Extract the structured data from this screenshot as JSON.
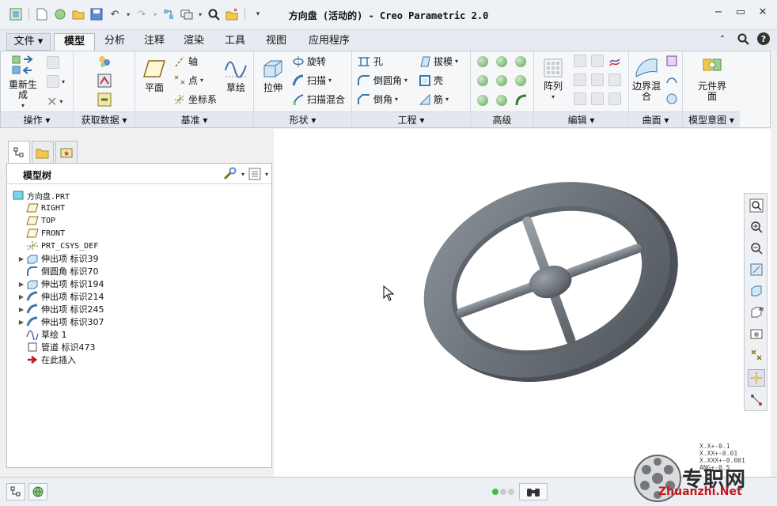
{
  "window": {
    "title": "方向盘 (活动的) - Creo Parametric 2.0",
    "quick_access_icons": [
      "regenerate-small-icon",
      "new-icon",
      "rebuild-icon",
      "open-icon",
      "save-icon",
      "undo-icon",
      "redo-icon",
      "regen-manager-icon",
      "windows-icon",
      "search-icon",
      "close-window-icon",
      "customize-icon"
    ]
  },
  "tabs": [
    {
      "label": "文件 ▾",
      "active": false
    },
    {
      "label": "模型",
      "active": true
    },
    {
      "label": "分析",
      "active": false
    },
    {
      "label": "注释",
      "active": false
    },
    {
      "label": "渲染",
      "active": false
    },
    {
      "label": "工具",
      "active": false
    },
    {
      "label": "视图",
      "active": false
    },
    {
      "label": "应用程序",
      "active": false
    }
  ],
  "ribbon": {
    "groups": {
      "operations": "操作 ▾",
      "get_data": "获取数据 ▾",
      "datum": "基准 ▾",
      "shapes": "形状 ▾",
      "engineering": "工程 ▾",
      "advanced": "高级",
      "editing": "编辑 ▾",
      "surfaces": "曲面 ▾",
      "model_intent": "模型意图 ▾"
    },
    "buttons": {
      "regenerate": "重新生成",
      "plane": "平面",
      "axis": "轴",
      "point": "点",
      "csys": "坐标系",
      "sketch": "草绘",
      "extrude": "拉伸",
      "revolve": "旋转",
      "sweep": "扫描",
      "swept_blend": "扫描混合",
      "hole": "孔",
      "round": "倒圆角",
      "chamfer": "倒角",
      "draft": "拔模",
      "shell": "壳",
      "rib": "筋",
      "pattern": "阵列",
      "boundary_blend": "边界混合",
      "component_interface": "元件界面"
    }
  },
  "model_tree": {
    "title": "模型树",
    "items": [
      {
        "label": "方向盘.PRT",
        "icon": "part-icon",
        "expandable": false,
        "level": 0
      },
      {
        "label": "RIGHT",
        "icon": "datum-plane-icon",
        "expandable": false,
        "level": 1
      },
      {
        "label": "TOP",
        "icon": "datum-plane-icon",
        "expandable": false,
        "level": 1
      },
      {
        "label": "FRONT",
        "icon": "datum-plane-icon",
        "expandable": false,
        "level": 1
      },
      {
        "label": "PRT_CSYS_DEF",
        "icon": "csys-icon",
        "expandable": false,
        "level": 1
      },
      {
        "label": "伸出项 标识39",
        "icon": "protrusion-icon",
        "expandable": true,
        "level": 1
      },
      {
        "label": "倒圆角 标识70",
        "icon": "round-icon",
        "expandable": false,
        "level": 1
      },
      {
        "label": "伸出项 标识194",
        "icon": "protrusion-icon",
        "expandable": true,
        "level": 1
      },
      {
        "label": "伸出项 标识214",
        "icon": "sweep-protrusion-icon",
        "expandable": true,
        "level": 1
      },
      {
        "label": "伸出项 标识245",
        "icon": "sweep-protrusion-icon",
        "expandable": true,
        "level": 1
      },
      {
        "label": "伸出项 标识307",
        "icon": "sweep-protrusion-icon",
        "expandable": true,
        "level": 1
      },
      {
        "label": "草绘 1",
        "icon": "sketch-icon",
        "expandable": false,
        "level": 1
      },
      {
        "label": "管道 标识473",
        "icon": "pipe-icon",
        "expandable": false,
        "level": 1
      },
      {
        "label": "在此插入",
        "icon": "insert-here-arrow-icon",
        "expandable": false,
        "level": 1
      }
    ]
  },
  "right_toolbar_icons": [
    "refit-icon",
    "zoom-in-icon",
    "zoom-out-icon",
    "repaint-icon",
    "display-style-icon",
    "saved-views-icon",
    "view-manager-icon",
    "datum-display-icon",
    "spin-center-icon",
    "annotation-display-icon"
  ],
  "tolerance_readout": [
    "X.X+-0.1",
    "X.XX+-0.01",
    "X.XXX+-0.001",
    "ANG+-0.5"
  ],
  "watermark": {
    "text": "专职网",
    "url": "Zhuanzhi.Net"
  },
  "colors": {
    "accent_green": "#5ea65a",
    "model_gray": "#6e757c",
    "watermark_red": "#c4161c"
  }
}
